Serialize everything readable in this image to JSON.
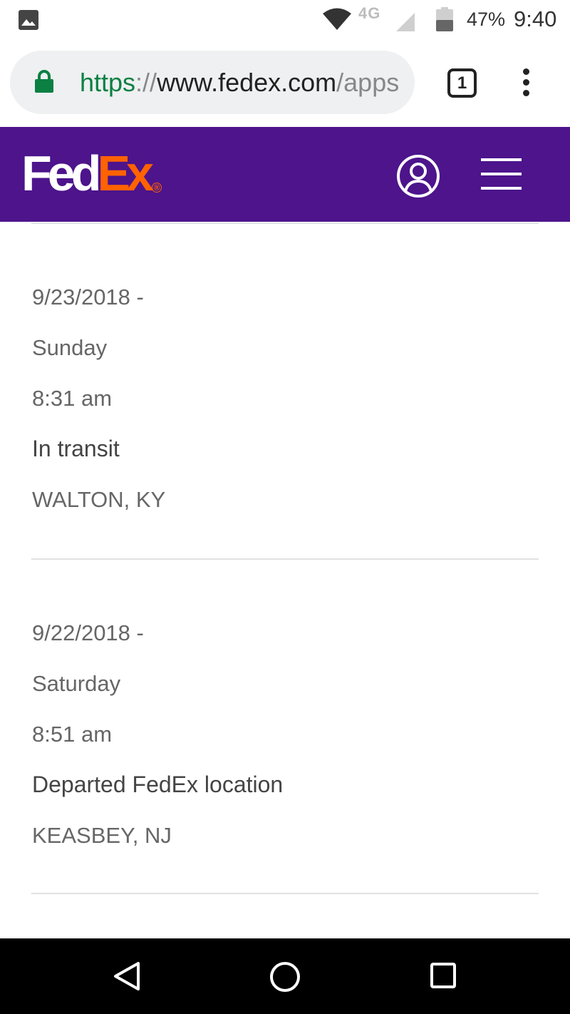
{
  "status_bar": {
    "network": "4G",
    "battery_percent": "47%",
    "time": "9:40",
    "icons": [
      "gallery-icon",
      "wifi-icon",
      "signal-icon",
      "battery-icon"
    ]
  },
  "browser": {
    "url_scheme": "https",
    "url_separator": "://",
    "url_host": "www.fedex.com",
    "url_path": "/apps",
    "tab_count": "1"
  },
  "header": {
    "logo_left": "Fed",
    "logo_right": "Ex",
    "logo_reg": "®",
    "brand_color": "#4d148c",
    "accent_color": "#ff6200"
  },
  "events": [
    {
      "date": "9/23/2018 -",
      "day": "Sunday",
      "time": "8:31 am",
      "status": "In transit",
      "location": "WALTON, KY"
    },
    {
      "date": "9/22/2018 -",
      "day": "Saturday",
      "time": "8:51 am",
      "status": "Departed FedEx location",
      "location": "KEASBEY, NJ"
    }
  ]
}
